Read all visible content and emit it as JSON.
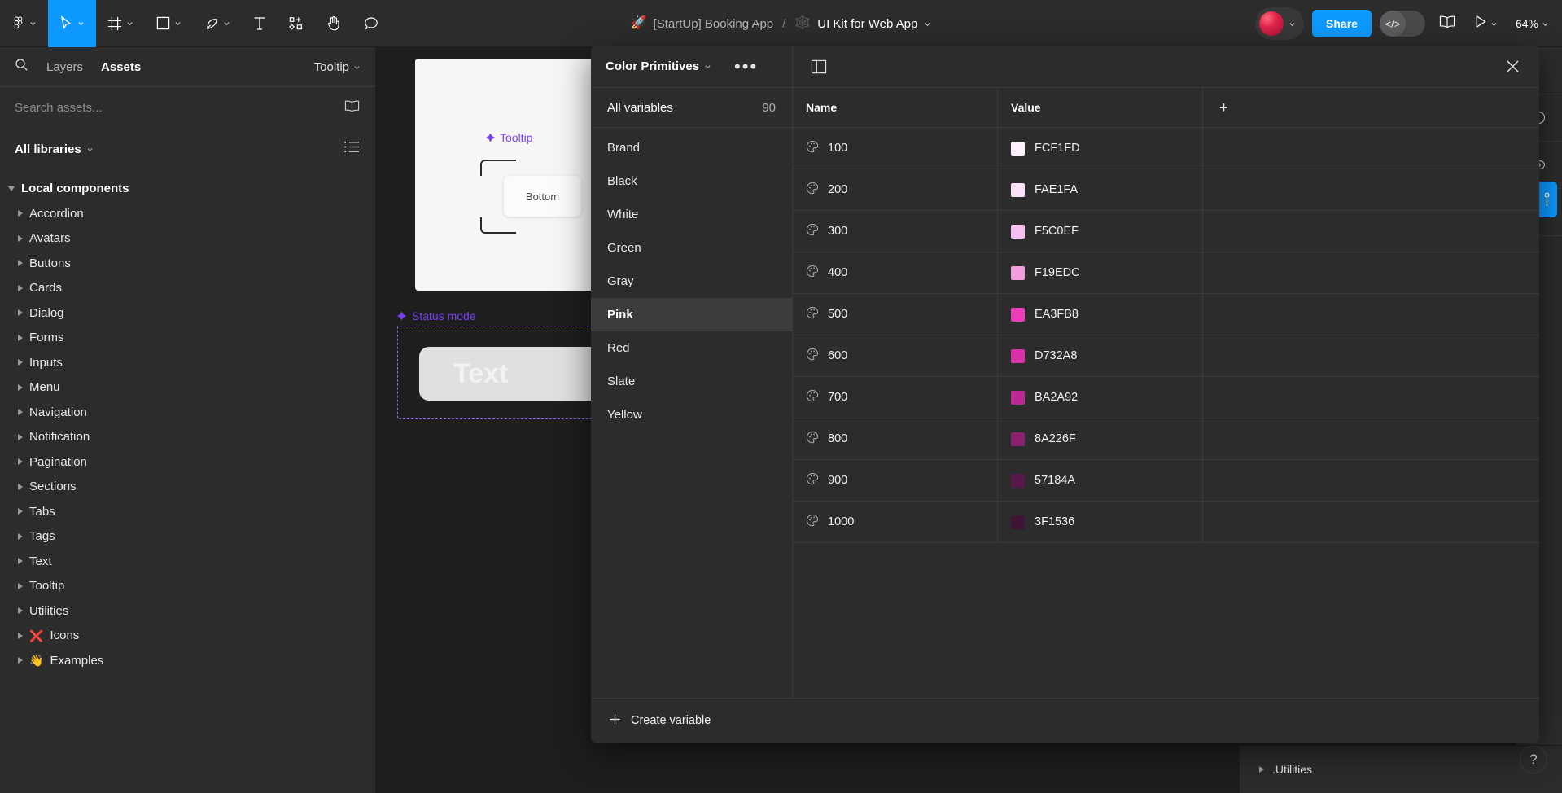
{
  "toolbar": {
    "tools": [
      {
        "name": "figma-logo-icon",
        "caret": true
      },
      {
        "name": "move-cursor-icon",
        "caret": true,
        "active": true
      },
      {
        "name": "frame-icon",
        "caret": true
      },
      {
        "name": "rectangle-icon",
        "caret": true
      },
      {
        "name": "pen-icon",
        "caret": true
      },
      {
        "name": "text-icon",
        "caret": false
      },
      {
        "name": "components-icon",
        "caret": false
      },
      {
        "name": "hand-icon",
        "caret": false
      },
      {
        "name": "comment-icon",
        "caret": false
      }
    ],
    "breadcrumb": {
      "project_emoji": "🚀",
      "project": "[StartUp] Booking App",
      "separator": "/",
      "file_emoji": "🕸️",
      "file": "UI Kit for Web App"
    },
    "share_label": "Share",
    "dev_mode_glyph": "</>",
    "zoom_label": "64%"
  },
  "sidebar": {
    "tabs": [
      {
        "label": "Layers",
        "active": false
      },
      {
        "label": "Assets",
        "active": true
      }
    ],
    "tooltip_selector": "Tooltip",
    "search_placeholder": "Search assets...",
    "search_value": "",
    "libraries_label": "All libraries",
    "local_components_label": "Local components",
    "components": [
      {
        "label": "Accordion",
        "emoji": ""
      },
      {
        "label": "Avatars",
        "emoji": ""
      },
      {
        "label": "Buttons",
        "emoji": ""
      },
      {
        "label": "Cards",
        "emoji": ""
      },
      {
        "label": "Dialog",
        "emoji": ""
      },
      {
        "label": "Forms",
        "emoji": ""
      },
      {
        "label": "Inputs",
        "emoji": ""
      },
      {
        "label": "Menu",
        "emoji": ""
      },
      {
        "label": "Navigation",
        "emoji": ""
      },
      {
        "label": "Notification",
        "emoji": ""
      },
      {
        "label": "Pagination",
        "emoji": ""
      },
      {
        "label": "Sections",
        "emoji": ""
      },
      {
        "label": "Tabs",
        "emoji": ""
      },
      {
        "label": "Tags",
        "emoji": ""
      },
      {
        "label": "Text",
        "emoji": ""
      },
      {
        "label": "Tooltip",
        "emoji": ""
      },
      {
        "label": "Utilities",
        "emoji": ""
      },
      {
        "label": "Icons",
        "emoji": "❌"
      },
      {
        "label": "Examples",
        "emoji": "👋"
      }
    ]
  },
  "canvas": {
    "tooltip_component_label": "Tooltip",
    "tooltip_button_label": "Bottom",
    "status_component_label": "Status mode",
    "status_text": "Text"
  },
  "modal": {
    "collection_name": "Color Primitives",
    "menu_glyph": "•••",
    "all_variables_label": "All variables",
    "all_variables_count": "90",
    "groups": [
      {
        "label": "Brand",
        "selected": false
      },
      {
        "label": "Black",
        "selected": false
      },
      {
        "label": "White",
        "selected": false
      },
      {
        "label": "Green",
        "selected": false
      },
      {
        "label": "Gray",
        "selected": false
      },
      {
        "label": "Pink",
        "selected": true
      },
      {
        "label": "Red",
        "selected": false
      },
      {
        "label": "Slate",
        "selected": false
      },
      {
        "label": "Yellow",
        "selected": false
      }
    ],
    "columns": {
      "name": "Name",
      "value": "Value",
      "add": "+"
    },
    "rows": [
      {
        "name": "100",
        "value": "FCF1FD",
        "swatch": "#FCF1FD"
      },
      {
        "name": "200",
        "value": "FAE1FA",
        "swatch": "#FAE1FA"
      },
      {
        "name": "300",
        "value": "F5C0EF",
        "swatch": "#F5C0EF"
      },
      {
        "name": "400",
        "value": "F19EDC",
        "swatch": "#F19EDC"
      },
      {
        "name": "500",
        "value": "EA3FB8",
        "swatch": "#EA3FB8"
      },
      {
        "name": "600",
        "value": "D732A8",
        "swatch": "#D732A8"
      },
      {
        "name": "700",
        "value": "BA2A92",
        "swatch": "#BA2A92"
      },
      {
        "name": "800",
        "value": "8A226F",
        "swatch": "#8A226F"
      },
      {
        "name": "900",
        "value": "57184A",
        "swatch": "#57184A"
      },
      {
        "name": "1000",
        "value": "3F1536",
        "swatch": "#3F1536"
      }
    ],
    "create_variable_label": "Create variable",
    "create_variable_glyph": "+"
  },
  "bottom_panel": {
    "label": ".Utilities"
  },
  "help": {
    "glyph": "?"
  },
  "colors": {
    "accent": "#0D99FF",
    "chrome": "#2C2C2C",
    "canvas": "#1E1E1E",
    "component_purple": "#7B3FF2"
  }
}
